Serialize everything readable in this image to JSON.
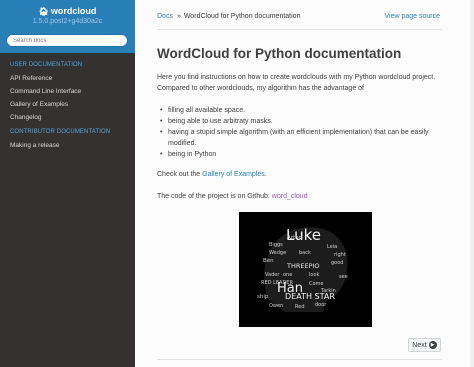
{
  "sidebar": {
    "project_name": "wordcloud",
    "version": "1.5.0.post2+g4d30a2c",
    "search_placeholder": "Search docs",
    "captions": [
      "User Documentation",
      "Contributor Documentation"
    ],
    "user_docs": [
      {
        "label": "API Reference"
      },
      {
        "label": "Command Line Interface"
      },
      {
        "label": "Gallery of Examples"
      },
      {
        "label": "Changelog"
      }
    ],
    "contributor_docs": [
      {
        "label": "Making a release"
      }
    ]
  },
  "breadcrumbs": {
    "home": "Docs",
    "separator": "»",
    "current": "WordCloud for Python documentation",
    "view_source": "View page source"
  },
  "page": {
    "title": "WordCloud for Python documentation",
    "intro": "Here you find instructions on how to create wordclouds with my Python wordcloud project. Compared to other wordclouds, my algorithm has the advantage of",
    "bullets": [
      "filling all available space.",
      "being able to use arbitraty masks.",
      "having a stupid simple algorithm (with an efficient implementation) that can be easily modified.",
      "being in Python"
    ],
    "checkout_prefix": "Check out the ",
    "checkout_link": "Gallery of Examples",
    "checkout_suffix": ".",
    "github_prefix": "The code of the project is on Github: ",
    "github_link": "word_cloud",
    "image_words": [
      "Luke",
      "Han",
      "DEATH STAR",
      "THREEPIO",
      "RED LEADER",
      "ship",
      "Artoo",
      "Biggs",
      "Wedge",
      "Ben",
      "Vader",
      "Tarkin",
      "Leia",
      "back",
      "door",
      "good",
      "look",
      "Come",
      "Owen",
      "Red",
      "see",
      "one",
      "right"
    ]
  },
  "footer": {
    "next_label": "Next",
    "next_icon": "circle-arrow-right-icon"
  },
  "colors": {
    "sidebar_bg": "#343131",
    "header_bg": "#2980b9",
    "caption": "#55a5d9",
    "link": "#2980b9",
    "visited_link": "#9b59b6",
    "text": "#404040"
  }
}
